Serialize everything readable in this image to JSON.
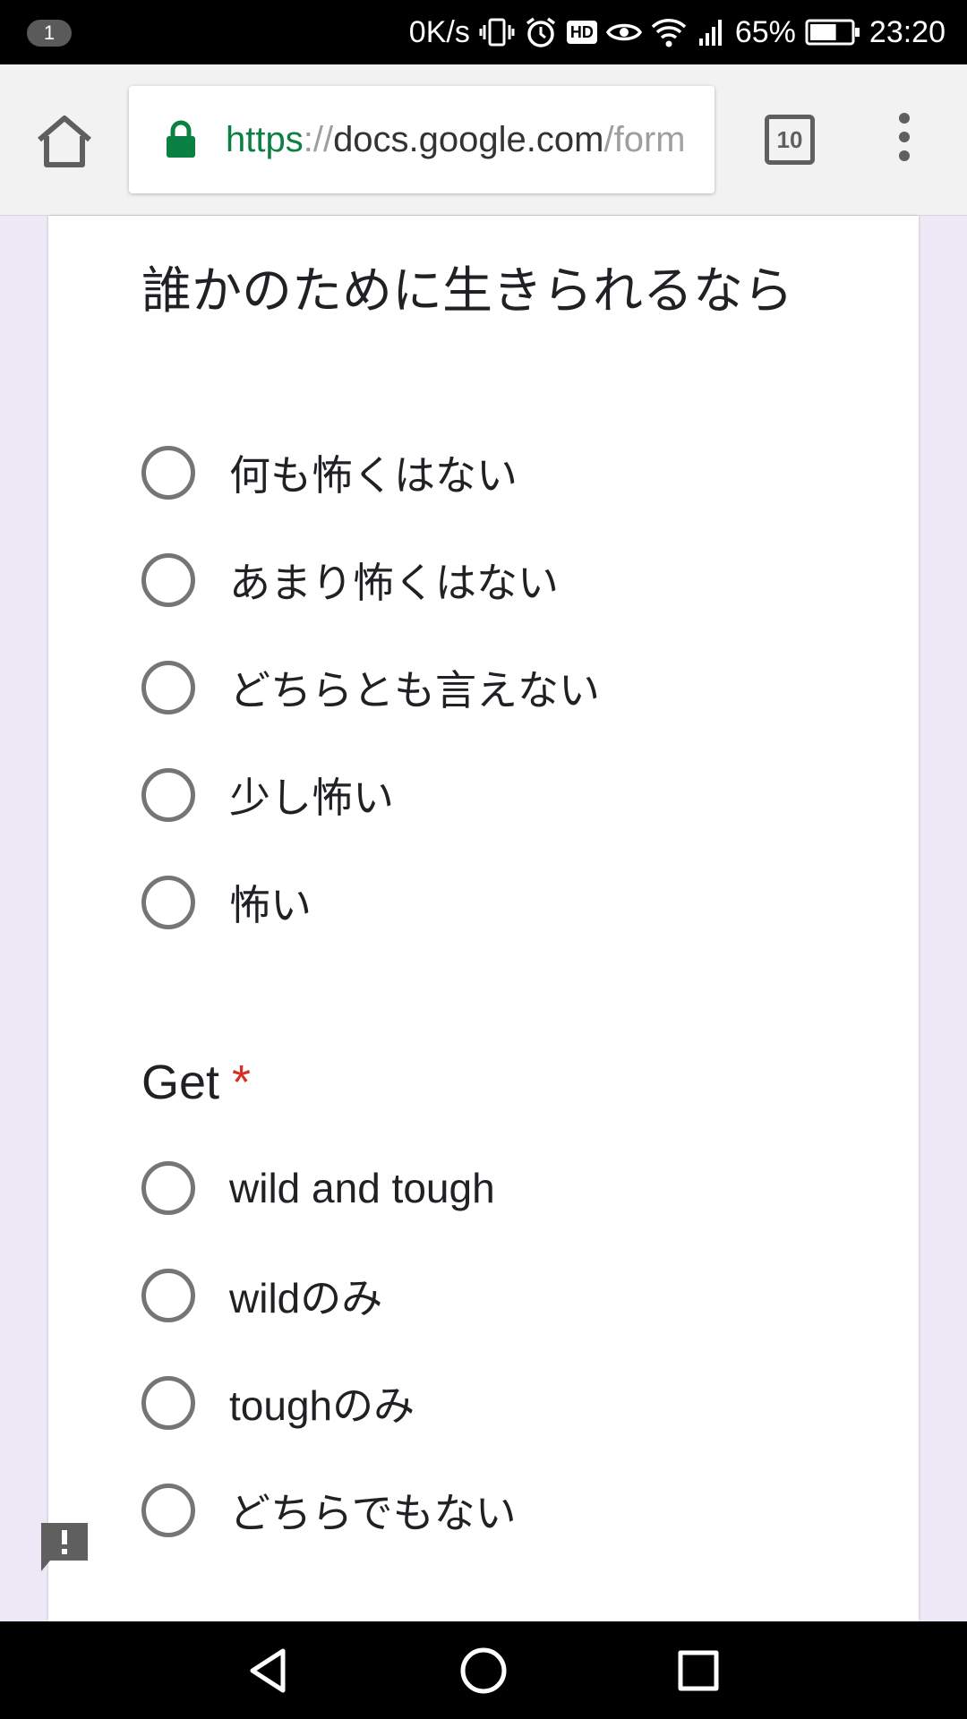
{
  "status_bar": {
    "notification_count": "1",
    "net_speed": "0K/s",
    "hd_badge": "HD",
    "battery": "65%",
    "time": "23:20",
    "battery_level_percent": 65
  },
  "toolbar": {
    "url_scheme": "https",
    "url_separator": "://",
    "url_host": "docs.google.com",
    "url_path": "/form",
    "tab_count": "10"
  },
  "form": {
    "questions": [
      {
        "title": "誰かのために生きられるなら",
        "required": false,
        "options": [
          "何も怖くはない",
          "あまり怖くはない",
          "どちらとも言えない",
          "少し怖い",
          "怖い"
        ]
      },
      {
        "title": "Get",
        "required": true,
        "required_marker": "*",
        "options": [
          "wild and tough",
          "wildのみ",
          "toughのみ",
          "どちらでもない"
        ]
      }
    ]
  },
  "colors": {
    "accent_secure": "#0b8043",
    "required": "#d93025",
    "page_background": "#ede7f6",
    "radio_border": "#757575"
  },
  "icons": {
    "home": "home-icon",
    "lock": "lock-icon",
    "tabs": "tab-switcher-icon",
    "menu": "more-vert-icon",
    "feedback": "feedback-icon",
    "back": "back-triangle-icon",
    "home_nav": "home-circle-icon",
    "recents": "recents-square-icon"
  }
}
